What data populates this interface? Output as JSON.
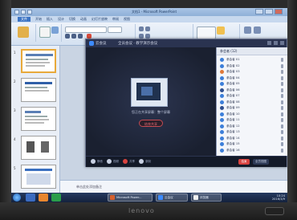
{
  "ppt": {
    "title": "文档1 - Microsoft PowerPoint",
    "tabs": [
      "文件",
      "开始",
      "插入",
      "设计",
      "切换",
      "动画",
      "幻灯片放映",
      "审阅",
      "视图"
    ],
    "slide_numbers": [
      "1",
      "2",
      "3",
      "4",
      "5"
    ],
    "notes_placeholder": "单击此处添加备注"
  },
  "conference": {
    "app_name": "云会议",
    "meeting_title": "全员会议 · 教学演示会议",
    "share_text": "您正在共享屏幕：整个屏幕",
    "stop_share": "结束共享",
    "panel_title": "参会者 (12)",
    "participants": [
      "参会者 01",
      "参会者 02",
      "参会者 03",
      "参会者 04",
      "参会者 05",
      "参会者 06",
      "参会者 07",
      "参会者 08",
      "参会者 09",
      "参会者 10",
      "参会者 11",
      "参会者 12",
      "参会者 13",
      "参会者 14",
      "参会者 15",
      "参会者 16"
    ],
    "toolbar": {
      "mute": "静音",
      "video": "视频",
      "share": "共享",
      "record": "录制",
      "end": "结束",
      "view": "全员视图"
    }
  },
  "taskbar": {
    "tasks": [
      "Microsoft Power...",
      "云会议",
      "浏览器"
    ],
    "time": "10:24",
    "date": "2016/3/9"
  },
  "monitor": {
    "brand": "lenovo"
  },
  "colors": {
    "ribbon": "#d4e1f1",
    "conference_bg": "#1f2638",
    "end_button": "#d9433f",
    "taskbar": "#25395f"
  }
}
